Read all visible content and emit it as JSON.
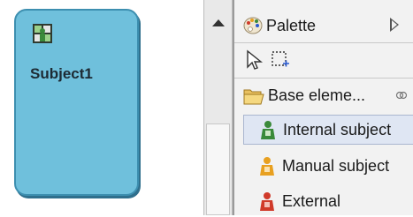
{
  "canvas": {
    "subject_label": "Subject1",
    "node_icon": "subject-node-icon"
  },
  "palette": {
    "title": "Palette",
    "title_icon": "palette-icon",
    "expand_icon": "expand-right-icon",
    "tools": [
      {
        "name": "select-tool",
        "icon": "arrow-cursor-icon"
      },
      {
        "name": "marquee-tool",
        "icon": "marquee-select-icon"
      }
    ],
    "drawer": {
      "label": "Base eleme...",
      "icon": "folder-open-icon",
      "pin_icon": "pin-icon"
    },
    "items": [
      {
        "label": "Internal subject",
        "icon": "person-green-icon",
        "color": "#3a8a3a",
        "selected": true
      },
      {
        "label": "Manual subject",
        "icon": "person-orange-icon",
        "color": "#e8a020",
        "selected": false
      },
      {
        "label": "External",
        "icon": "person-red-icon",
        "color": "#d03a2a",
        "selected": false
      }
    ]
  },
  "colors": {
    "node_fill": "#6fc0dc",
    "node_border": "#3d8fb0"
  }
}
